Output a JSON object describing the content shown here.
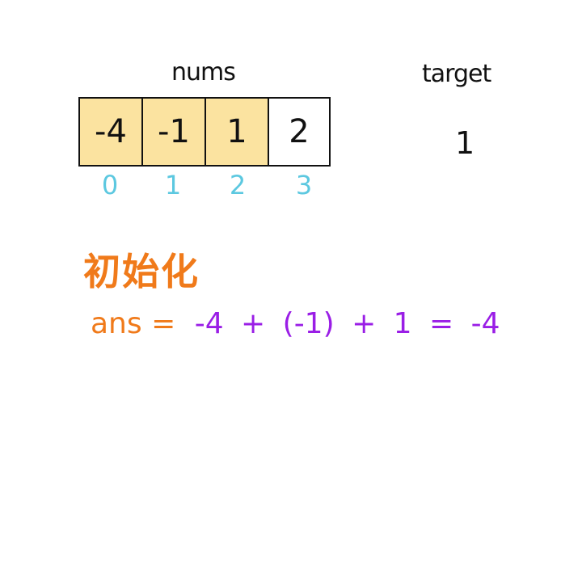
{
  "array": {
    "label": "nums",
    "cells": [
      {
        "value": "-4",
        "index": "0",
        "highlighted": true
      },
      {
        "value": "-1",
        "index": "1",
        "highlighted": true
      },
      {
        "value": "1",
        "index": "2",
        "highlighted": true
      },
      {
        "value": "2",
        "index": "3",
        "highlighted": false
      }
    ]
  },
  "target": {
    "label": "target",
    "value": "1"
  },
  "init": {
    "title": "初始化",
    "lhs": "ans =",
    "rhs": "-4 + (-1) + 1 = -4"
  },
  "colors": {
    "highlight": "#fbe3a0",
    "index": "#5cc8e0",
    "title": "#f07a1a",
    "formula": "#9a1ee6"
  }
}
